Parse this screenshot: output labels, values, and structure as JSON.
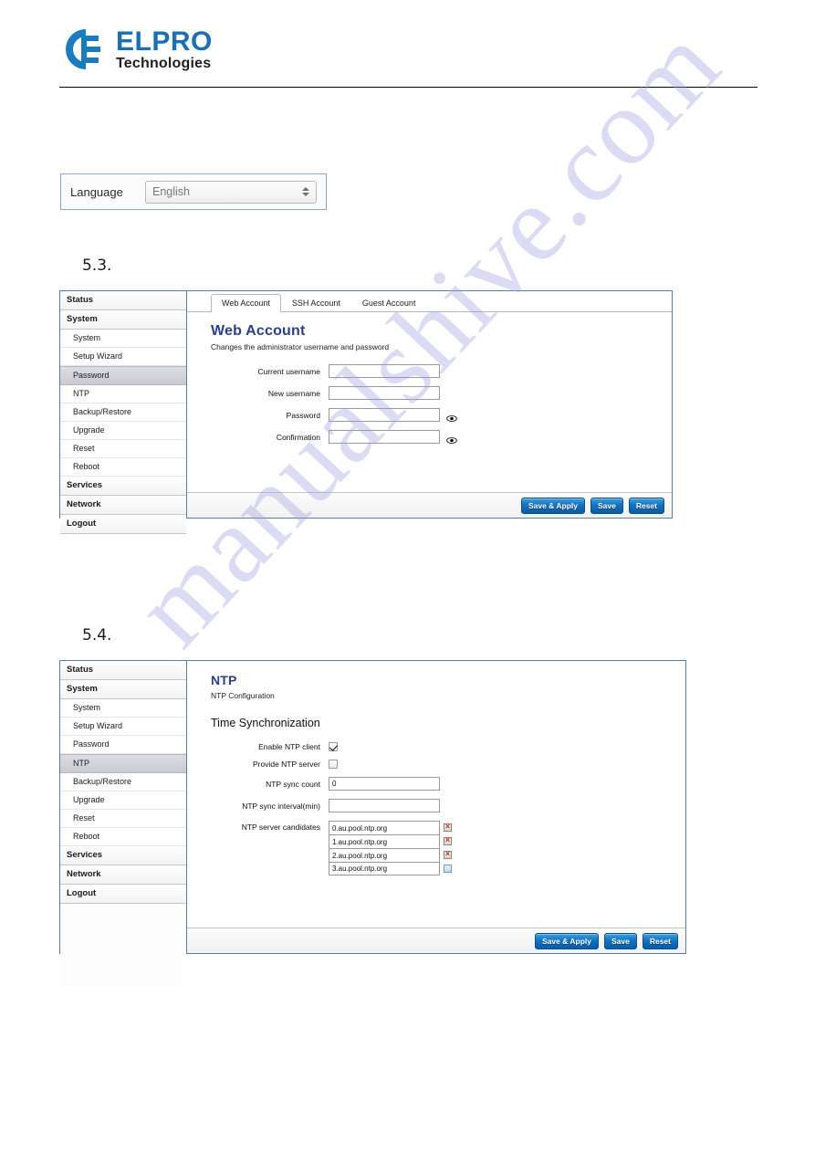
{
  "document": {
    "logo": {
      "title": "ELPRO",
      "subtitle": "Technologies",
      "mark_icon": "elpro-e-globe-icon",
      "brand_color": "#1a6fb5"
    },
    "watermark": "manualshive.com",
    "sections": [
      {
        "number": "5.3."
      },
      {
        "number": "5.4."
      }
    ]
  },
  "language_box": {
    "label": "Language",
    "selected": "English",
    "stepper_icon": "up-down-stepper-icon"
  },
  "web_account_screenshot": {
    "sidebar": [
      {
        "label": "Status",
        "type": "group",
        "selected": false
      },
      {
        "label": "System",
        "type": "group",
        "selected": false
      },
      {
        "label": "System",
        "type": "item",
        "selected": false
      },
      {
        "label": "Setup Wizard",
        "type": "item",
        "selected": false
      },
      {
        "label": "Password",
        "type": "item",
        "selected": true
      },
      {
        "label": "NTP",
        "type": "item",
        "selected": false
      },
      {
        "label": "Backup/Restore",
        "type": "item",
        "selected": false
      },
      {
        "label": "Upgrade",
        "type": "item",
        "selected": false
      },
      {
        "label": "Reset",
        "type": "item",
        "selected": false
      },
      {
        "label": "Reboot",
        "type": "item",
        "selected": false
      },
      {
        "label": "Services",
        "type": "group",
        "selected": false
      },
      {
        "label": "Network",
        "type": "group",
        "selected": false
      },
      {
        "label": "Logout",
        "type": "group",
        "selected": false
      }
    ],
    "tabs": [
      {
        "label": "Web Account",
        "active": true
      },
      {
        "label": "SSH Account",
        "active": false
      },
      {
        "label": "Guest Account",
        "active": false
      }
    ],
    "title": "Web Account",
    "subtitle": "Changes the administrator username and password",
    "fields": [
      {
        "label": "Current username",
        "value": "",
        "has_eye": false
      },
      {
        "label": "New username",
        "value": "",
        "has_eye": false
      },
      {
        "label": "Password",
        "value": "",
        "has_eye": true
      },
      {
        "label": "Confirmation",
        "value": "",
        "has_eye": true
      }
    ],
    "buttons": [
      {
        "label": "Save & Apply"
      },
      {
        "label": "Save"
      },
      {
        "label": "Reset"
      }
    ]
  },
  "ntp_screenshot": {
    "sidebar": [
      {
        "label": "Status",
        "type": "group",
        "selected": false
      },
      {
        "label": "System",
        "type": "group",
        "selected": false
      },
      {
        "label": "System",
        "type": "item",
        "selected": false
      },
      {
        "label": "Setup Wizard",
        "type": "item",
        "selected": false
      },
      {
        "label": "Password",
        "type": "item",
        "selected": false
      },
      {
        "label": "NTP",
        "type": "item",
        "selected": true
      },
      {
        "label": "Backup/Restore",
        "type": "item",
        "selected": false
      },
      {
        "label": "Upgrade",
        "type": "item",
        "selected": false
      },
      {
        "label": "Reset",
        "type": "item",
        "selected": false
      },
      {
        "label": "Reboot",
        "type": "item",
        "selected": false
      },
      {
        "label": "Services",
        "type": "group",
        "selected": false
      },
      {
        "label": "Network",
        "type": "group",
        "selected": false
      },
      {
        "label": "Logout",
        "type": "group",
        "selected": false
      }
    ],
    "title": "NTP",
    "subtitle": "NTP Configuration",
    "section_heading": "Time Synchronization",
    "checkboxes": [
      {
        "label": "Enable NTP client",
        "checked": true
      },
      {
        "label": "Provide NTP server",
        "checked": false
      }
    ],
    "fields": [
      {
        "label": "NTP sync count",
        "value": "0"
      },
      {
        "label": "NTP sync interval(min)",
        "value": ""
      }
    ],
    "candidates_label": "NTP server candidates",
    "candidates": [
      {
        "value": "0.au.pool.ntp.org",
        "icon": "remove-icon"
      },
      {
        "value": "1.au.pool.ntp.org",
        "icon": "remove-icon"
      },
      {
        "value": "2.au.pool.ntp.org",
        "icon": "remove-icon"
      },
      {
        "value": "3.au.pool.ntp.org",
        "icon": "add-icon"
      }
    ],
    "buttons": [
      {
        "label": "Save & Apply"
      },
      {
        "label": "Save"
      },
      {
        "label": "Reset"
      }
    ]
  }
}
